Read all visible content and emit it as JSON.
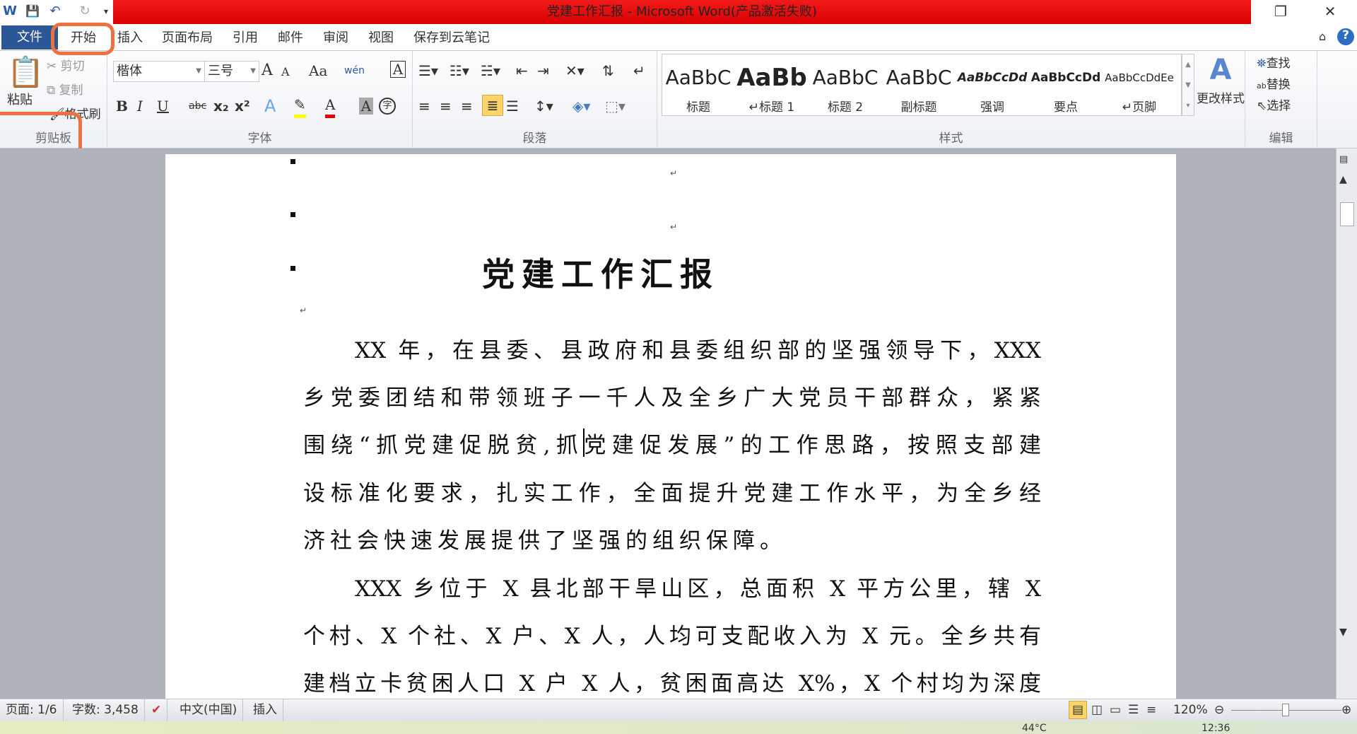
{
  "window": {
    "title": "党建工作汇报 - Microsoft Word(产品激活失败)"
  },
  "quick_access": {
    "word": "W",
    "save": "💾",
    "undo": "↶",
    "redo": "↻",
    "more": "▾"
  },
  "tabs": [
    "文件",
    "开始",
    "插入",
    "页面布局",
    "引用",
    "邮件",
    "审阅",
    "视图",
    "保存到云笔记"
  ],
  "clipboard": {
    "paste": "粘贴",
    "cut": "剪切",
    "copy": "复制",
    "format_painter": "格式刷",
    "label": "剪贴板"
  },
  "font": {
    "name": "楷体",
    "size": "三号",
    "label": "字体",
    "grow": "A",
    "shrink": "A",
    "case": "Aa",
    "bold": "B",
    "italic": "I",
    "underline": "U",
    "strike": "abc",
    "sub": "x₂",
    "sup": "x²",
    "char_border": "A",
    "phonetic": "wén",
    "clear": "A",
    "effects": "A",
    "highlight": "✎",
    "color": "A",
    "shade": "A",
    "enclose": "字"
  },
  "paragraph": {
    "label": "段落"
  },
  "styles": {
    "label": "样式",
    "items": [
      {
        "preview": "AaBbC",
        "name": "标题"
      },
      {
        "preview": "AaBb",
        "name": "↵标题 1"
      },
      {
        "preview": "AaBbC",
        "name": "标题 2"
      },
      {
        "preview": "AaBbC",
        "name": "副标题"
      },
      {
        "preview": "AaBbCcDd",
        "name": "强调"
      },
      {
        "preview": "AaBbCcDd",
        "name": "要点"
      },
      {
        "preview": "AaBbCcDdEe",
        "name": "↵页脚"
      }
    ],
    "change": "更改样式"
  },
  "editing": {
    "label": "编辑",
    "find": "查找",
    "replace": "替换",
    "select": "选择"
  },
  "document": {
    "title": "党建工作汇报",
    "lines": [
      "XX 年，在县委、县政府和县委组织部的坚强领导下，XXX",
      "乡党委团结和带领班子一千人及全乡广大党员干部群众，紧紧",
      "围绕“抓党建促脱贫,抓党建促发展”的工作思路，按照支部建",
      "设标准化要求，扎实工作，全面提升党建工作水平，为全乡经",
      "济社会快速发展提供了坚强的组织保障。",
      "XXX 乡位于 X 县北部干旱山区，总面积 X 平方公里，辖 X",
      "个村、X 个社、X 户、X 人，人均可支配收入为 X 元。全乡共有",
      "建档立卡贫困人口 X 户 X 人，贫困面高达 X%，X 个村均为深度"
    ]
  },
  "status": {
    "page": "页面: 1/6",
    "words": "字数: 3,458",
    "lang": "中文(中国)",
    "mode": "插入",
    "zoom": "120%"
  },
  "taskbar": {
    "temp": "44°C",
    "time": "12:36"
  }
}
